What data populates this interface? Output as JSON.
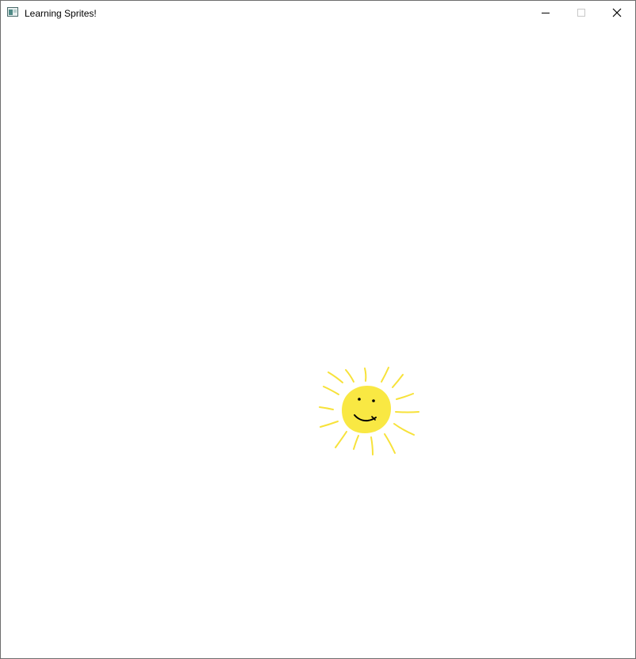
{
  "window": {
    "title": "Learning Sprites!",
    "icon": "app-window-icon",
    "controls": {
      "minimize_icon": "minimize-icon",
      "maximize_icon": "maximize-icon",
      "close_icon": "close-icon"
    }
  },
  "canvas": {
    "background": "#ffffff",
    "sprite": {
      "name": "sun-sprite",
      "body_color": "#f9e843",
      "ray_color": "#f7e23a",
      "face_color": "#000000"
    }
  }
}
